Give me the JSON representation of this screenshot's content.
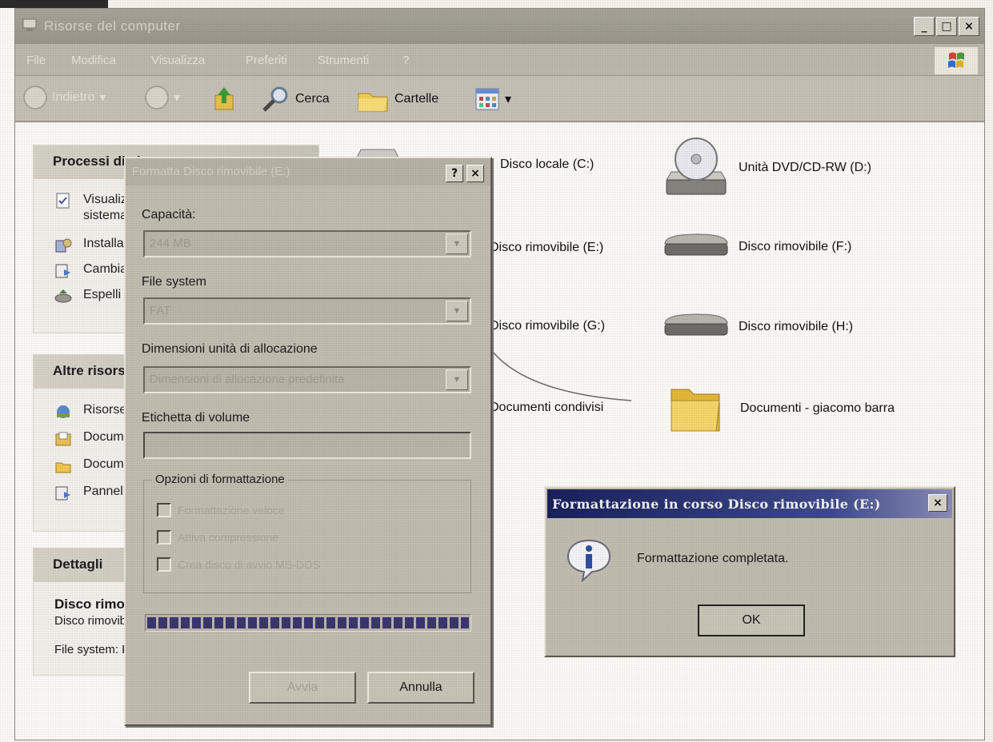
{
  "window": {
    "title": "Risorse del computer",
    "min_label": "_",
    "max_label": "□",
    "close_label": "×"
  },
  "menubar": {
    "items": [
      "File",
      "Modifica",
      "Visualizza",
      "Preferiti",
      "Strumenti",
      "?"
    ]
  },
  "toolbar": {
    "back_label": "Indietro",
    "search_label": "Cerca",
    "folders_label": "Cartelle"
  },
  "tasks_pane": {
    "system_tasks": {
      "title": "Processi di sistema",
      "items": [
        "Visualizza informazioni sul sistema",
        "Installazione applicazioni",
        "Cambia impostazione",
        "Espelli"
      ]
    },
    "other_places": {
      "title": "Altre risorse",
      "items": [
        "Risorse di rete",
        "Documenti",
        "Documenti condivisi",
        "Pannello di controllo"
      ]
    },
    "details": {
      "title": "Dettagli",
      "name": "Disco rimovibile (E:)",
      "type": "Disco rimovibile",
      "fs": "File system: FAT"
    }
  },
  "drives": {
    "c": "Disco locale (C:)",
    "d": "Unità DVD/CD-RW (D:)",
    "e": "Disco rimovibile (E:)",
    "f": "Disco rimovibile (F:)",
    "g": "Disco rimovibile (G:)",
    "h": "Disco rimovibile (H:)",
    "shared": "Documenti condivisi",
    "docs": "Documenti - giacomo barra"
  },
  "format_dialog": {
    "title": "Formatta Disco rimovibile (E:)",
    "help_label": "?",
    "close_label": "×",
    "capacity_label": "Capacità:",
    "capacity_value": "244 MB",
    "fs_label": "File system",
    "fs_value": "FAT",
    "alloc_label": "Dimensioni unità di allocazione",
    "alloc_value": "Dimensioni di allocazione predefinita",
    "volume_label": "Etichetta di volume",
    "volume_value": "",
    "options_title": "Opzioni di formattazione",
    "options": [
      "Formattazione veloce",
      "Attiva compressione",
      "Crea disco di avvio MS-DOS"
    ],
    "progress": 1.0,
    "start_label": "Avvia",
    "cancel_label": "Annulla"
  },
  "message_box": {
    "title": "Formattazione in corso Disco rimovibile (E:)",
    "close_label": "×",
    "text": "Formattazione completata.",
    "ok_label": "OK"
  },
  "colors": {
    "msg_title_bar": "#19215a",
    "progress_fill": "#3b3670"
  }
}
